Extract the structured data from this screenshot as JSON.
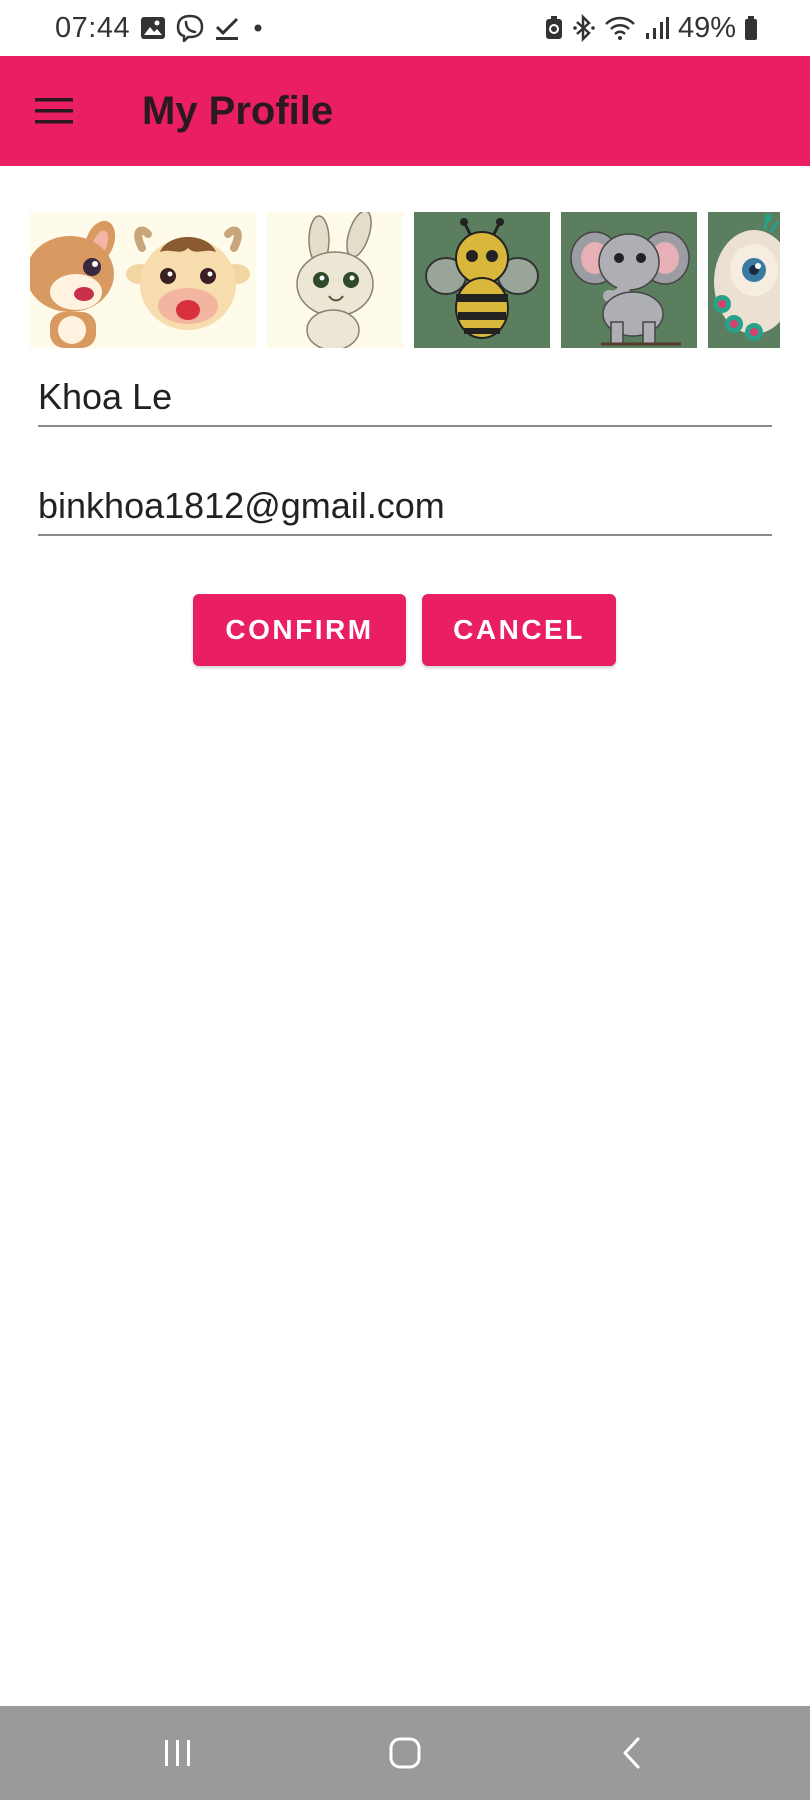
{
  "status_bar": {
    "time": "07:44",
    "battery": "49%",
    "left_icons": [
      "image-icon",
      "viber-icon",
      "check-icon",
      "dot-icon"
    ],
    "right_icons": [
      "battery-saver-icon",
      "bluetooth-icon",
      "wifi-icon",
      "signal-icon",
      "battery-icon"
    ]
  },
  "app_bar": {
    "title": "My Profile",
    "background_color": "#e91e63",
    "menu_icon": "hamburger-menu-icon"
  },
  "avatars": [
    {
      "name": "kangaroo",
      "background": "#fffbea"
    },
    {
      "name": "cow",
      "background": "#fffbea"
    },
    {
      "name": "bunny",
      "background": "#fffbea"
    },
    {
      "name": "bee",
      "background": "#5b7f5e"
    },
    {
      "name": "elephant",
      "background": "#5b7f5e"
    },
    {
      "name": "peacock",
      "background": "#5b7f5e"
    }
  ],
  "form": {
    "name_value": "Khoa Le",
    "email_value": "binkhoa1812@gmail.com"
  },
  "buttons": {
    "confirm_label": "CONFIRM",
    "cancel_label": "CANCEL"
  },
  "nav_bar": {
    "icons": [
      "recent-apps-icon",
      "home-icon",
      "back-icon"
    ]
  }
}
